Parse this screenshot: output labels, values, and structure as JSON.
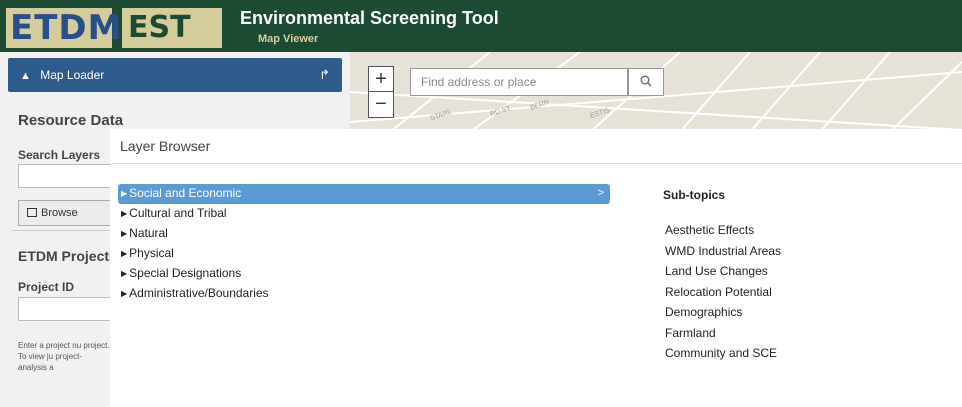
{
  "header": {
    "logo_left": "ETDM",
    "logo_right": "EST",
    "title": "Environmental Screening Tool",
    "subtitle": "Map Viewer"
  },
  "left_panel": {
    "map_loader_label": "Map Loader",
    "resource_heading": "Resource Data",
    "search_label": "Search Layers",
    "browse_label": "Browse",
    "etdm_heading": "ETDM Projects",
    "project_label": "Project ID",
    "hint": "Enter a project nu project. To view ju project-analysis a"
  },
  "map": {
    "zoom_in": "+",
    "zoom_out": "−",
    "search_placeholder": "Find address or place",
    "street_labels": [
      "STARL",
      "RD ST",
      "BERR",
      "ESTIS"
    ]
  },
  "layer_browser": {
    "title": "Layer Browser",
    "topics": [
      {
        "label": "Social and Economic",
        "selected": true
      },
      {
        "label": "Cultural and Tribal",
        "selected": false
      },
      {
        "label": "Natural",
        "selected": false
      },
      {
        "label": "Physical",
        "selected": false
      },
      {
        "label": "Special Designations",
        "selected": false
      },
      {
        "label": "Administrative/Boundaries",
        "selected": false
      }
    ],
    "selected_arrow": ">",
    "subtopics_heading": "Sub-topics",
    "subtopics": [
      "Aesthetic Effects",
      "WMD Industrial Areas",
      "Land Use Changes",
      "Relocation Potential",
      "Demographics",
      "Farmland",
      "Community and SCE"
    ]
  },
  "colors": {
    "header_bg": "#1c4a33",
    "logo_bg": "#d4cc9a",
    "accent_blue": "#2c5b8c",
    "selected_topic": "#5b9bd5"
  }
}
